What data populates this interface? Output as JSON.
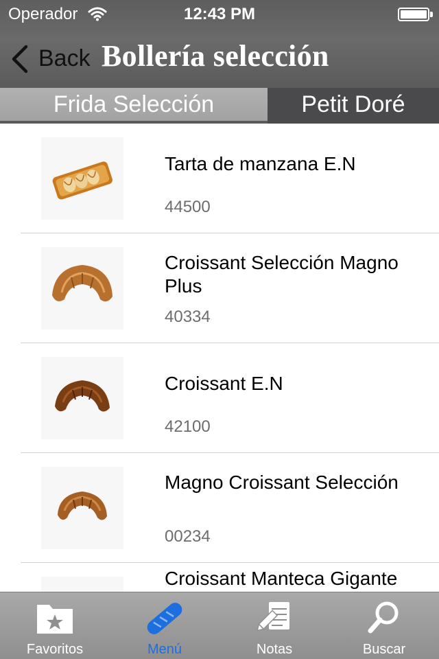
{
  "status_bar": {
    "carrier": "Operador",
    "time": "12:43 PM"
  },
  "nav": {
    "back_label": "Back",
    "title": "Bollería selección"
  },
  "segments": [
    {
      "label": "Frida Selección",
      "selected": true
    },
    {
      "label": "Petit Doré",
      "selected": false
    }
  ],
  "products": [
    {
      "name": "Tarta de manzana E.N",
      "code": "44500",
      "icon": "apple-pastry-image"
    },
    {
      "name": "Croissant Selección Magno Plus",
      "code": "40334",
      "icon": "croissant-image"
    },
    {
      "name": "Croissant E.N",
      "code": "42100",
      "icon": "croissant-image"
    },
    {
      "name": "Magno Croissant Selección",
      "code": "00234",
      "icon": "croissant-image"
    },
    {
      "name": "Croissant Manteca Gigante Selección",
      "code": "",
      "icon": "croissant-image"
    }
  ],
  "tabbar": [
    {
      "label": "Favoritos",
      "icon": "folder-star-icon",
      "active": false
    },
    {
      "label": "Menú",
      "icon": "baguette-icon",
      "active": true
    },
    {
      "label": "Notas",
      "icon": "notes-pencil-icon",
      "active": false
    },
    {
      "label": "Buscar",
      "icon": "magnifier-icon",
      "active": false
    }
  ],
  "colors": {
    "nav_bg": "#5e5e5f",
    "segment_selected": "#a8a8a8",
    "segment_unselected": "#4a4a4c",
    "tab_active": "#1d6fe0",
    "code_text": "#6d6d6d"
  }
}
